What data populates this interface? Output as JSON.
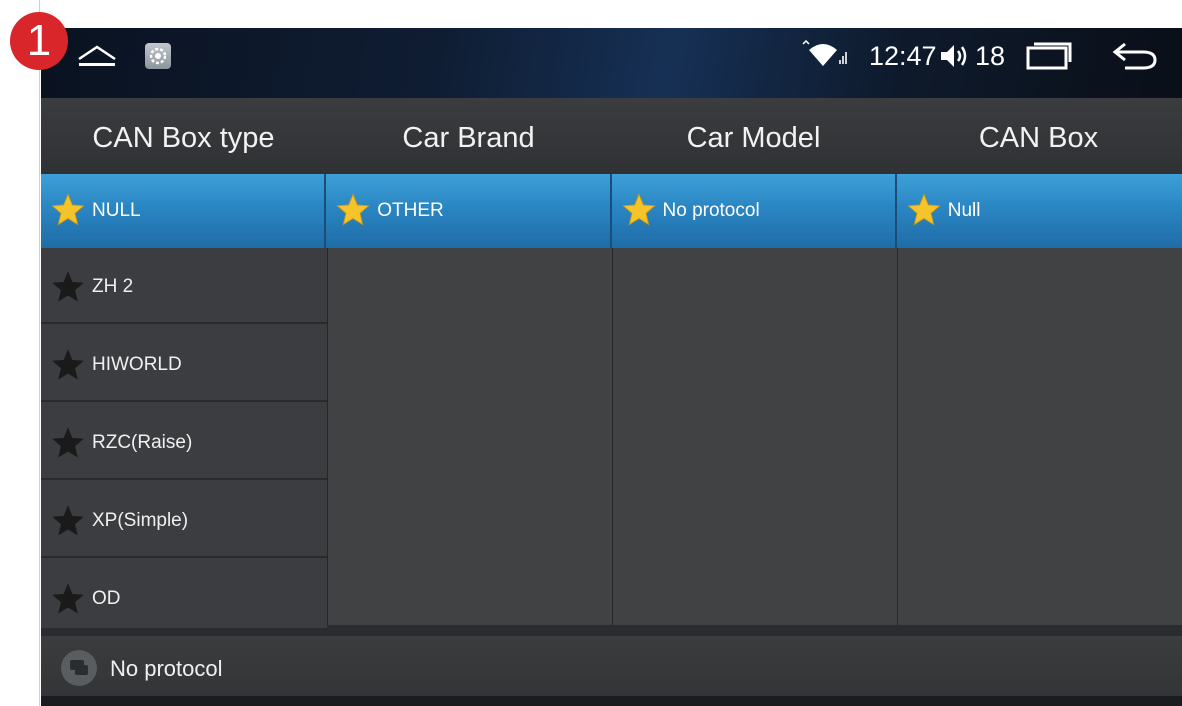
{
  "step_badge": "1",
  "status_bar": {
    "time": "12:47",
    "volume_level": "18",
    "icons": [
      "home-icon",
      "settings-icon",
      "wifi-icon",
      "signal-icon",
      "volume-icon",
      "recent-apps-icon",
      "back-icon"
    ]
  },
  "columns": {
    "headers": [
      "CAN Box type",
      "Car Brand",
      "Car Model",
      "CAN Box"
    ]
  },
  "selected_row": [
    {
      "label": "NULL",
      "icon": "star-gold-icon"
    },
    {
      "label": "OTHER",
      "icon": "star-gold-icon"
    },
    {
      "label": "No protocol",
      "icon": "star-gold-icon"
    },
    {
      "label": "Null",
      "icon": "star-gold-icon"
    }
  ],
  "can_box_types": [
    {
      "label": "ZH 2",
      "icon": "star-dark-icon"
    },
    {
      "label": "HIWORLD",
      "icon": "star-dark-icon"
    },
    {
      "label": "RZC(Raise)",
      "icon": "star-dark-icon"
    },
    {
      "label": "XP(Simple)",
      "icon": "star-dark-icon"
    },
    {
      "label": "OD",
      "icon": "star-dark-icon"
    }
  ],
  "bottom_status": {
    "text": "No protocol",
    "icon": "message-icon"
  },
  "colors": {
    "selected_row": "#2a86c3",
    "star_gold": "#f5c42a",
    "star_dark": "#1a1a1a",
    "step_badge": "#d8262b"
  }
}
